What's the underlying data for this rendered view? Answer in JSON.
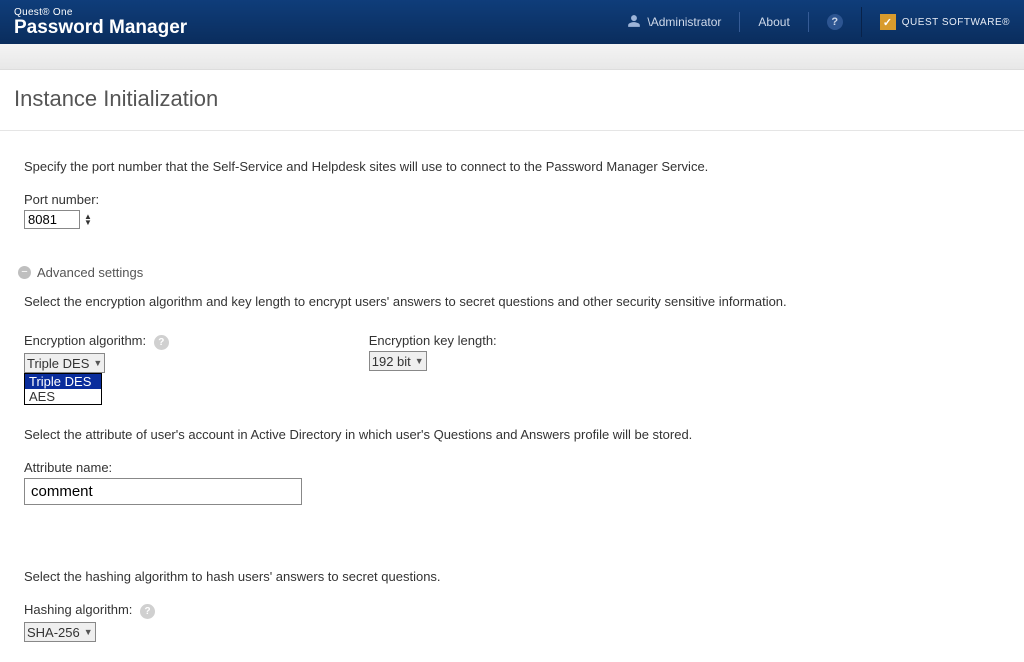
{
  "header": {
    "brand_small": "Quest® One",
    "brand_big": "Password Manager",
    "user_prefix": "\\Administrator",
    "about": "About",
    "vendor": "QUEST SOFTWARE®"
  },
  "page": {
    "title": "Instance Initialization"
  },
  "port": {
    "description": "Specify the port number that the Self-Service and Helpdesk sites will use to connect to the Password Manager Service.",
    "label": "Port number:",
    "value": "8081"
  },
  "advanced": {
    "toggle_label": "Advanced settings",
    "encryption_desc": "Select the encryption algorithm and key length to encrypt users' answers to secret questions and other security sensitive information.",
    "algo_label": "Encryption algorithm:",
    "algo_selected": "Triple DES",
    "algo_options": [
      "Triple DES",
      "AES"
    ],
    "keylen_label": "Encryption key length:",
    "keylen_value": "192 bit",
    "attribute_desc": "Select the attribute of user's account in Active Directory in which user's Questions and Answers profile will be stored.",
    "attribute_label": "Attribute name:",
    "attribute_value": "comment",
    "hashing_desc": "Select the hashing algorithm to hash users' answers to secret questions.",
    "hashing_label": "Hashing algorithm:",
    "hashing_value": "SHA-256"
  }
}
